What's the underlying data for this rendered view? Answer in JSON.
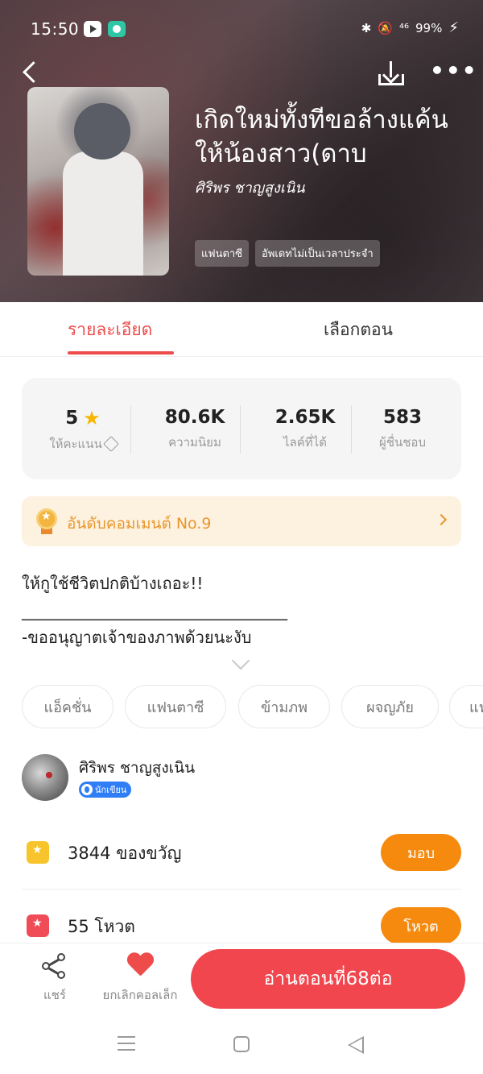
{
  "status_bar": {
    "time": "15:50",
    "network": "⁴⁶",
    "battery": "99%"
  },
  "header": {
    "title": "เกิดใหม่ทั้งทีขอล้างแค้นให้น้องสาว(ดาบ",
    "author": "ศิริพร ชาญสูงเนิน",
    "tags": [
      "แฟนตาซี",
      "อัพเดทไม่เป็นเวลาประจำ"
    ]
  },
  "tabs": [
    {
      "label": "รายละเอียด",
      "active": true
    },
    {
      "label": "เลือกตอน",
      "active": false
    }
  ],
  "stats": [
    {
      "value": "5",
      "label": "ให้คะแนน"
    },
    {
      "value": "80.6K",
      "label": "ความนิยม"
    },
    {
      "value": "2.65K",
      "label": "ไลค์ที่ได้"
    },
    {
      "value": "583",
      "label": "ผู้ชื่นชอบ"
    }
  ],
  "rank_banner": {
    "text": "อันดับคอมเมนต์ No.9"
  },
  "description": {
    "line1": "ให้กูใช้ชีวิตปกติบ้างเถอะ!!",
    "line2": "_________________________________",
    "line3": "-ขออนุญาตเจ้าของภาพด้วยนะงับ"
  },
  "genres": [
    "แอ็คชั่น",
    "แฟนตาซี",
    "ข้ามภพ",
    "ผจญภัย",
    "แฟ"
  ],
  "writer": {
    "name": "ศิริพร ชาญสูงเนิน",
    "badge": "นักเขียน"
  },
  "gift": {
    "text": "3844 ของขวัญ",
    "button": "มอบ"
  },
  "vote": {
    "text": "55 โหวต",
    "button": "โหวต"
  },
  "bottom_bar": {
    "share_label": "แชร์",
    "favorite_label": "ยกเลิกคอลเล็ก",
    "read_button": "อ่านตอนที่68ต่อ"
  },
  "colors": {
    "accent_red": "#ee4b4b",
    "orange": "#f58a0f",
    "rank_bg": "#fdf2df",
    "rank_text": "#e9962e"
  }
}
